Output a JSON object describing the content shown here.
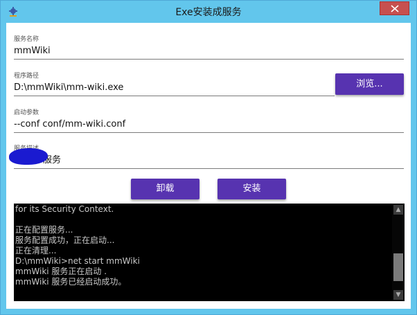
{
  "window": {
    "title": "Exe安装成服务",
    "app_icon": "gear-icon",
    "close_icon": "close-icon",
    "titlebar_color": "#62c6ec",
    "close_color": "#c7504f"
  },
  "fields": {
    "service_name": {
      "label": "服务名称",
      "value": "mmWiki"
    },
    "program_path": {
      "label": "程序路径",
      "value": "D:\\mmWiki\\mm-wiki.exe"
    },
    "start_args": {
      "label": "启动参数",
      "value": "--conf conf/mm-wiki.conf"
    },
    "service_desc": {
      "label": "服务描述",
      "value": "服务"
    }
  },
  "buttons": {
    "browse": "浏览...",
    "uninstall": "卸载",
    "install": "安装",
    "accent": "#5733b0"
  },
  "console": {
    "lines": [
      "for its Security Context.",
      "",
      "正在配置服务...",
      "服务配置成功，正在启动...",
      "正在清理...",
      "D:\\mmWiki>net start mmWiki",
      "mmWiki 服务正在启动 .",
      "mmWiki 服务已经启动成功。"
    ],
    "scroll_up_icon": "arrow-up-icon",
    "scroll_down_icon": "arrow-down-icon"
  }
}
